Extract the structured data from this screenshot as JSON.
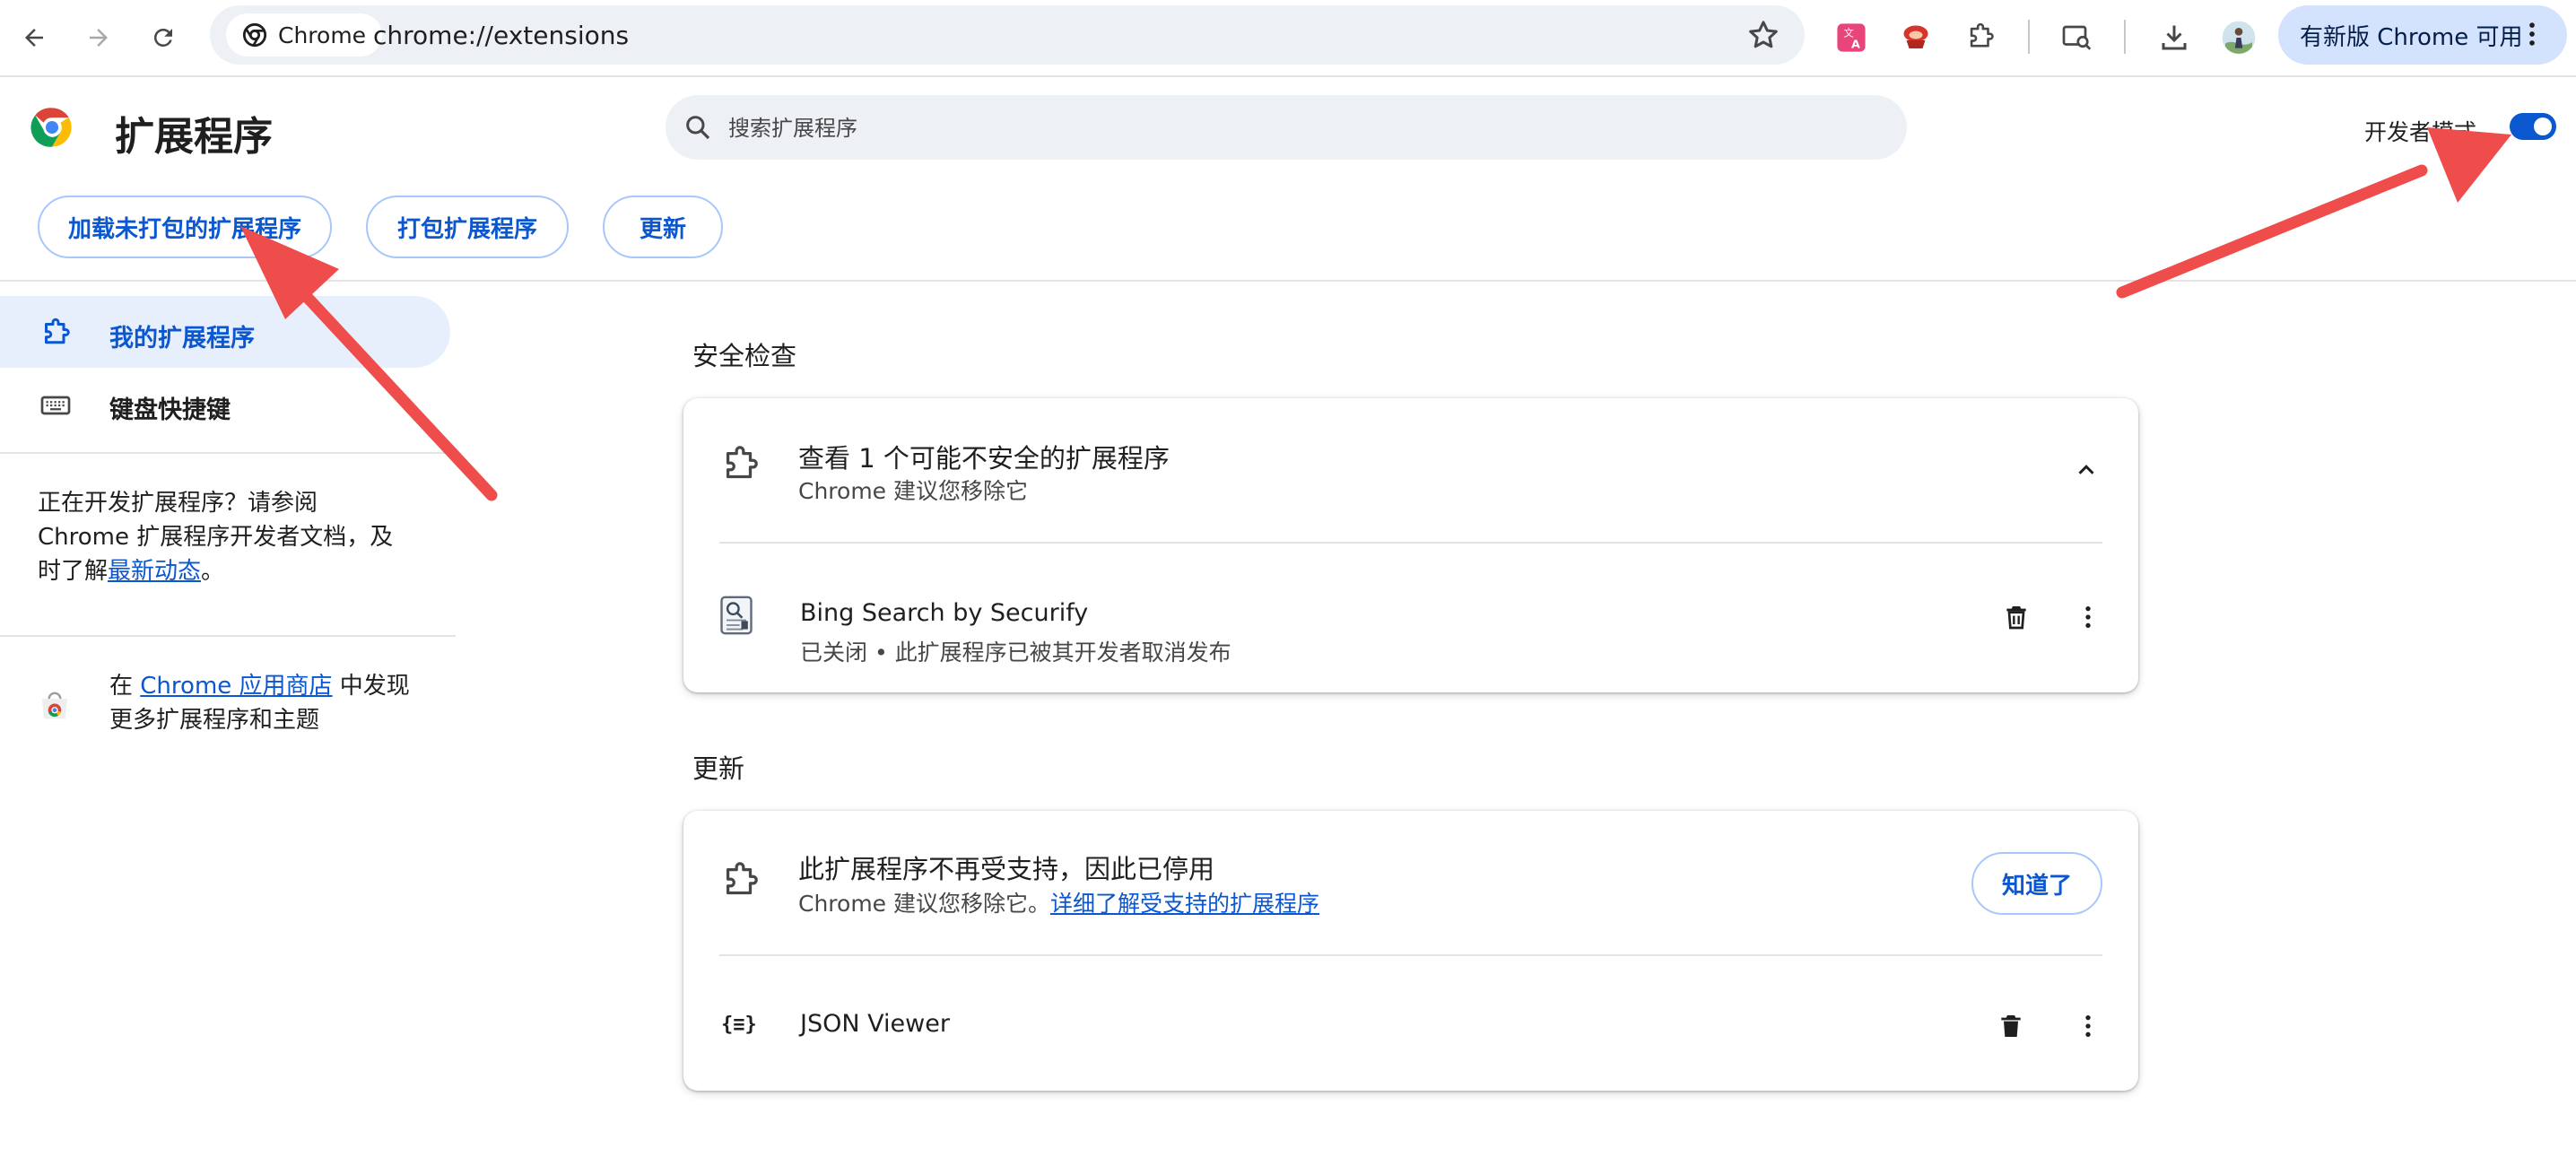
{
  "browser": {
    "site_chip": "Chrome",
    "url": "chrome://extensions",
    "update_button": "有新版 Chrome 可用",
    "icons": [
      "back-icon",
      "forward-icon",
      "reload-icon",
      "star-icon",
      "translate-icon",
      "extension-icon",
      "puzzle-icon",
      "search-page-icon",
      "download-icon",
      "avatar",
      "more-icon"
    ]
  },
  "page": {
    "title": "扩展程序",
    "search_placeholder": "搜索扩展程序",
    "developer_mode_label": "开发者模式",
    "developer_mode_on": true
  },
  "actions": {
    "load_unpacked": "加载未打包的扩展程序",
    "pack": "打包扩展程序",
    "update": "更新"
  },
  "sidebar": {
    "items": [
      {
        "label": "我的扩展程序",
        "icon": "extension-icon",
        "active": true
      },
      {
        "label": "键盘快捷键",
        "icon": "keyboard-icon",
        "active": false
      }
    ],
    "dev_text_before": "正在开发扩展程序？请参阅 Chrome 扩展程序开发者文档，及时了解",
    "dev_link": "最新动态",
    "dev_text_after": "。",
    "store_text_before": "在",
    "store_link": "Chrome 应用商店",
    "store_text_after": "中发现更多扩展程序和主题"
  },
  "safety": {
    "section_title": "安全检查",
    "card_title": "查看 1 个可能不安全的扩展程序",
    "card_subtitle": "Chrome 建议您移除它",
    "extension": {
      "name": "Bing Search by Securify",
      "status": "已关闭 • 此扩展程序已被其开发者取消发布"
    }
  },
  "updates": {
    "section_title": "更新",
    "card_title": "此扩展程序不再受支持，因此已停用",
    "card_subtitle_before": "Chrome 建议您移除它。",
    "card_subtitle_link": "详细了解受支持的扩展程序",
    "got_it_button": "知道了",
    "extension": {
      "name": "JSON Viewer",
      "icon_text": "{≡}"
    }
  },
  "colors": {
    "accent": "#0b57d0",
    "annotation_arrow": "#ef4c4c"
  }
}
